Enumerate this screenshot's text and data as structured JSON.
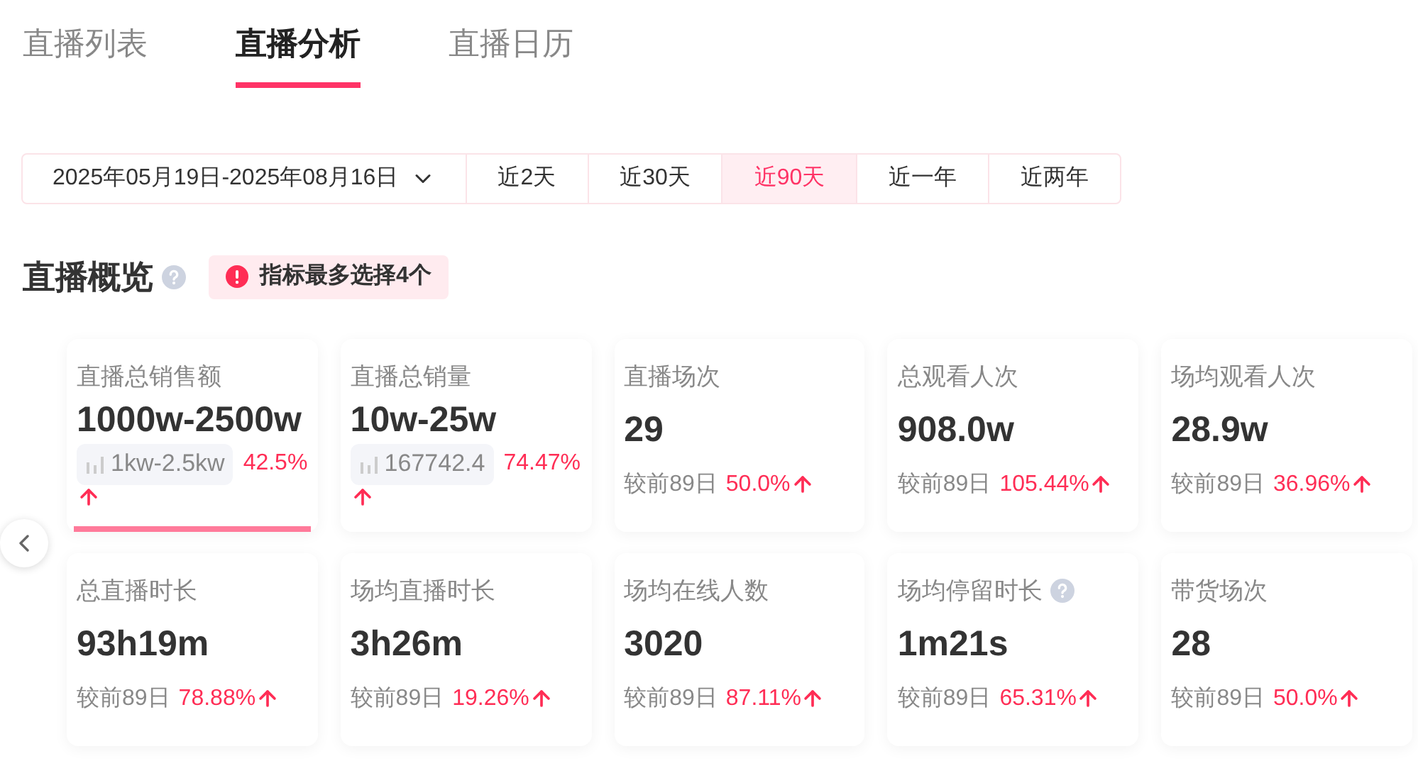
{
  "tabs": [
    {
      "label": "直播列表",
      "selected": false
    },
    {
      "label": "直播分析",
      "selected": true
    },
    {
      "label": "直播日历",
      "selected": false
    }
  ],
  "date_range": {
    "label": "2025年05月19日-2025年08月16日"
  },
  "periods": [
    {
      "label": "近2天",
      "selected": false
    },
    {
      "label": "近30天",
      "selected": false
    },
    {
      "label": "近90天",
      "selected": true
    },
    {
      "label": "近一年",
      "selected": false
    },
    {
      "label": "近两年",
      "selected": false
    }
  ],
  "section": {
    "title": "直播概览",
    "notice": "指标最多选择4个"
  },
  "cards": [
    {
      "kind": "range",
      "label": "直播总销售额",
      "value": "1000w-2500w",
      "estimate": "1kw-2.5kw",
      "change": "42.5%",
      "help": false,
      "selected": true
    },
    {
      "kind": "range",
      "label": "直播总销量",
      "value": "10w-25w",
      "estimate": "167742.4",
      "change": "74.47%",
      "help": false,
      "selected": false
    },
    {
      "kind": "compare",
      "label": "直播场次",
      "value": "29",
      "compare": "较前89日",
      "change": "50.0%",
      "help": false,
      "selected": false
    },
    {
      "kind": "compare",
      "label": "总观看人次",
      "value": "908.0w",
      "compare": "较前89日",
      "change": "105.44%",
      "help": false,
      "selected": false
    },
    {
      "kind": "compare",
      "label": "场均观看人次",
      "value": "28.9w",
      "compare": "较前89日",
      "change": "36.96%",
      "help": false,
      "selected": false
    },
    {
      "kind": "compare",
      "label": "总直播时长",
      "value": "93h19m",
      "compare": "较前89日",
      "change": "78.88%",
      "help": false,
      "selected": false
    },
    {
      "kind": "compare",
      "label": "场均直播时长",
      "value": "3h26m",
      "compare": "较前89日",
      "change": "19.26%",
      "help": false,
      "selected": false
    },
    {
      "kind": "compare",
      "label": "场均在线人数",
      "value": "3020",
      "compare": "较前89日",
      "change": "87.11%",
      "help": false,
      "selected": false
    },
    {
      "kind": "compare",
      "label": "场均停留时长",
      "value": "1m21s",
      "compare": "较前89日",
      "change": "65.31%",
      "help": true,
      "selected": false
    },
    {
      "kind": "compare",
      "label": "带货场次",
      "value": "28",
      "compare": "较前89日",
      "change": "50.0%",
      "help": false,
      "selected": false
    }
  ]
}
